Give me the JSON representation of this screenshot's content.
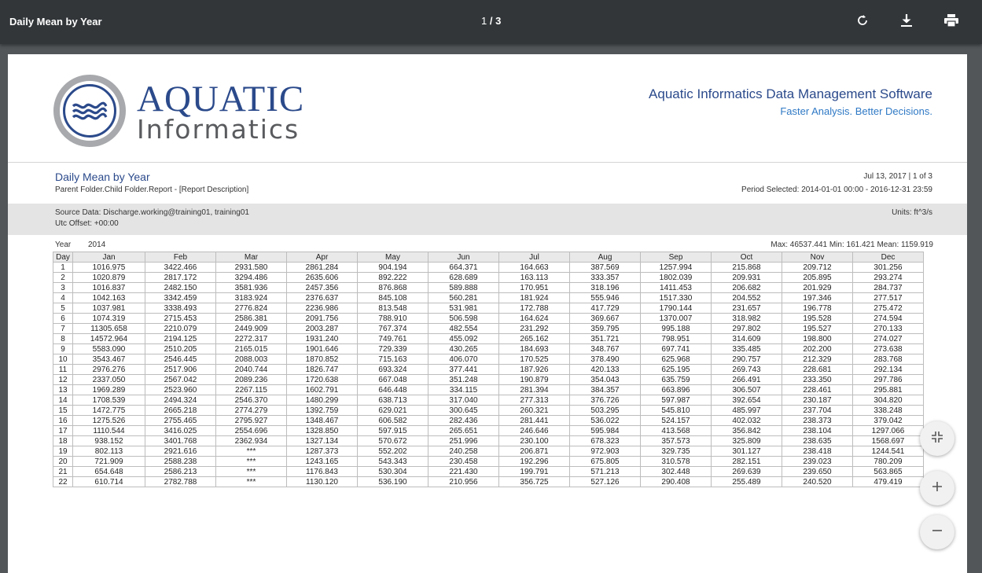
{
  "toolbar": {
    "title": "Daily Mean by Year",
    "page_current": "1",
    "page_sep": "/",
    "page_total": "3",
    "icons": [
      "rotate-icon",
      "download-icon",
      "print-icon"
    ]
  },
  "logo": {
    "line1": "AQUATIC",
    "line2": "Informatics",
    "accent": "#2b4a8b"
  },
  "company": {
    "name": "Aquatic Informatics Data Management Software",
    "tagline": "Faster Analysis. Better Decisions."
  },
  "report": {
    "title": "Daily Mean by Year",
    "path": "Parent Folder.Child Folder.Report - [Report Description]",
    "date": "Jul 13, 2017 | 1 of 3",
    "period": "Period Selected: 2014-01-01 00:00 - 2016-12-31 23:59",
    "source": "Source Data: Discharge.working@training01, training01",
    "utc": "Utc Offset: +00:00",
    "units": "Units: ft^3/s"
  },
  "year": {
    "label": "Year",
    "value": "2014",
    "stats": "Max: 46537.441 Min: 161.421 Mean: 1159.919"
  },
  "table": {
    "headers": [
      "Day",
      "Jan",
      "Feb",
      "Mar",
      "Apr",
      "May",
      "Jun",
      "Jul",
      "Aug",
      "Sep",
      "Oct",
      "Nov",
      "Dec"
    ],
    "rows": [
      [
        "1",
        "1016.975",
        "3422.466",
        "2931.580",
        "2861.284",
        "904.194",
        "664.371",
        "164.663",
        "387.569",
        "1257.994",
        "215.868",
        "209.712",
        "301.256"
      ],
      [
        "2",
        "1020.879",
        "2817.172",
        "3294.486",
        "2635.606",
        "892.222",
        "628.689",
        "163.113",
        "333.357",
        "1802.039",
        "209.931",
        "205.895",
        "293.274"
      ],
      [
        "3",
        "1016.837",
        "2482.150",
        "3581.936",
        "2457.356",
        "876.868",
        "589.888",
        "170.951",
        "318.196",
        "1411.453",
        "206.682",
        "201.929",
        "284.737"
      ],
      [
        "4",
        "1042.163",
        "3342.459",
        "3183.924",
        "2376.637",
        "845.108",
        "560.281",
        "181.924",
        "555.946",
        "1517.330",
        "204.552",
        "197.346",
        "277.517"
      ],
      [
        "5",
        "1037.981",
        "3338.493",
        "2776.824",
        "2236.986",
        "813.548",
        "531.981",
        "172.788",
        "417.729",
        "1790.144",
        "231.657",
        "196.778",
        "275.472"
      ],
      [
        "6",
        "1074.319",
        "2715.453",
        "2586.381",
        "2091.756",
        "788.910",
        "506.598",
        "164.624",
        "369.667",
        "1370.007",
        "318.982",
        "195.528",
        "274.594"
      ],
      [
        "7",
        "11305.658",
        "2210.079",
        "2449.909",
        "2003.287",
        "767.374",
        "482.554",
        "231.292",
        "359.795",
        "995.188",
        "297.802",
        "195.527",
        "270.133"
      ],
      [
        "8",
        "14572.964",
        "2194.125",
        "2272.317",
        "1931.240",
        "749.761",
        "455.092",
        "265.162",
        "351.721",
        "798.951",
        "314.609",
        "198.800",
        "274.027"
      ],
      [
        "9",
        "5583.090",
        "2510.205",
        "2165.015",
        "1901.646",
        "729.339",
        "430.265",
        "184.693",
        "348.767",
        "697.741",
        "335.485",
        "202.200",
        "273.638"
      ],
      [
        "10",
        "3543.467",
        "2546.445",
        "2088.003",
        "1870.852",
        "715.163",
        "406.070",
        "170.525",
        "378.490",
        "625.968",
        "290.757",
        "212.329",
        "283.768"
      ],
      [
        "11",
        "2976.276",
        "2517.906",
        "2040.744",
        "1826.747",
        "693.324",
        "377.441",
        "187.926",
        "420.133",
        "625.195",
        "269.743",
        "228.681",
        "292.134"
      ],
      [
        "12",
        "2337.050",
        "2567.042",
        "2089.236",
        "1720.638",
        "667.048",
        "351.248",
        "190.879",
        "354.043",
        "635.759",
        "266.491",
        "233.350",
        "297.786"
      ],
      [
        "13",
        "1969.289",
        "2523.960",
        "2267.115",
        "1602.791",
        "646.448",
        "334.115",
        "281.394",
        "384.357",
        "663.896",
        "306.507",
        "228.461",
        "295.881"
      ],
      [
        "14",
        "1708.539",
        "2494.324",
        "2546.370",
        "1480.299",
        "638.713",
        "317.040",
        "277.313",
        "376.726",
        "597.987",
        "392.654",
        "230.187",
        "304.820"
      ],
      [
        "15",
        "1472.775",
        "2665.218",
        "2774.279",
        "1392.759",
        "629.021",
        "300.645",
        "260.321",
        "503.295",
        "545.810",
        "485.997",
        "237.704",
        "338.248"
      ],
      [
        "16",
        "1275.526",
        "2755.465",
        "2795.927",
        "1348.467",
        "606.582",
        "282.436",
        "281.441",
        "536.022",
        "524.157",
        "402.032",
        "238.373",
        "379.042"
      ],
      [
        "17",
        "1110.544",
        "3416.025",
        "2554.696",
        "1328.850",
        "597.915",
        "265.651",
        "246.646",
        "595.984",
        "413.568",
        "356.842",
        "238.104",
        "1297.066"
      ],
      [
        "18",
        "938.152",
        "3401.768",
        "2362.934",
        "1327.134",
        "570.672",
        "251.996",
        "230.100",
        "678.323",
        "357.573",
        "325.809",
        "238.635",
        "1568.697"
      ],
      [
        "19",
        "802.113",
        "2921.616",
        "***",
        "1287.373",
        "552.202",
        "240.258",
        "206.871",
        "972.903",
        "329.735",
        "301.127",
        "238.418",
        "1244.541"
      ],
      [
        "20",
        "721.909",
        "2588.238",
        "***",
        "1243.165",
        "543.343",
        "230.458",
        "192.296",
        "675.805",
        "310.578",
        "282.151",
        "239.023",
        "780.209"
      ],
      [
        "21",
        "654.648",
        "2586.213",
        "***",
        "1176.843",
        "530.304",
        "221.430",
        "199.791",
        "571.213",
        "302.448",
        "269.639",
        "239.650",
        "563.865"
      ],
      [
        "22",
        "610.714",
        "2782.788",
        "***",
        "1130.120",
        "536.190",
        "210.956",
        "356.725",
        "527.126",
        "290.408",
        "255.489",
        "240.520",
        "479.419"
      ]
    ]
  },
  "fabs": [
    "fit-page-icon",
    "zoom-in-icon",
    "zoom-out-icon"
  ]
}
